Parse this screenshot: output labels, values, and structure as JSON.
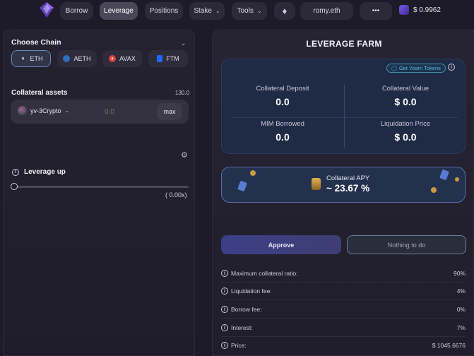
{
  "nav": {
    "items": [
      {
        "label": "Borrow"
      },
      {
        "label": "Leverage"
      },
      {
        "label": "Positions"
      },
      {
        "label": "Stake"
      },
      {
        "label": "Tools"
      }
    ],
    "account": "romy.eth",
    "more": "•••",
    "price": "$ 0.9962"
  },
  "left": {
    "title": "Choose Chain",
    "chains": [
      {
        "label": "ETH"
      },
      {
        "label": "AETH"
      },
      {
        "label": "AVAX"
      },
      {
        "label": "FTM"
      }
    ],
    "collateral_title": "Collateral assets",
    "collateral_balance": "130.0",
    "token": "yv-3Crypto",
    "amount_placeholder": "0.0",
    "max_label": "max",
    "leverage_title": "Leverage up",
    "leverage_value": "( 0.00x)"
  },
  "right": {
    "title": "LEVERAGE FARM",
    "yearn_link": "Get Yearn Tokens",
    "stats": [
      {
        "label": "Collateral Deposit",
        "value": "0.0"
      },
      {
        "label": "Collateral Value",
        "value": "$ 0.0"
      },
      {
        "label": "MIM Borrowed",
        "value": "0.0"
      },
      {
        "label": "Liquidation Price",
        "value": "$ 0.0"
      }
    ],
    "apy_label": "Collateral APY",
    "apy_value": "~ 23.67 %",
    "approve_label": "Approve",
    "nothing_label": "Nothing to do",
    "info": [
      {
        "label": "Maximum collateral ratio:",
        "value": "90%"
      },
      {
        "label": "Liquidation fee:",
        "value": "4%"
      },
      {
        "label": "Borrow fee:",
        "value": "0%"
      },
      {
        "label": "Interest:",
        "value": "7%"
      },
      {
        "label": "Price:",
        "value": "$ 1045.6676"
      }
    ]
  },
  "colors": {
    "background": "#1d1b27",
    "accent": "#4a4a9a",
    "yearn": "#56b8d9"
  }
}
